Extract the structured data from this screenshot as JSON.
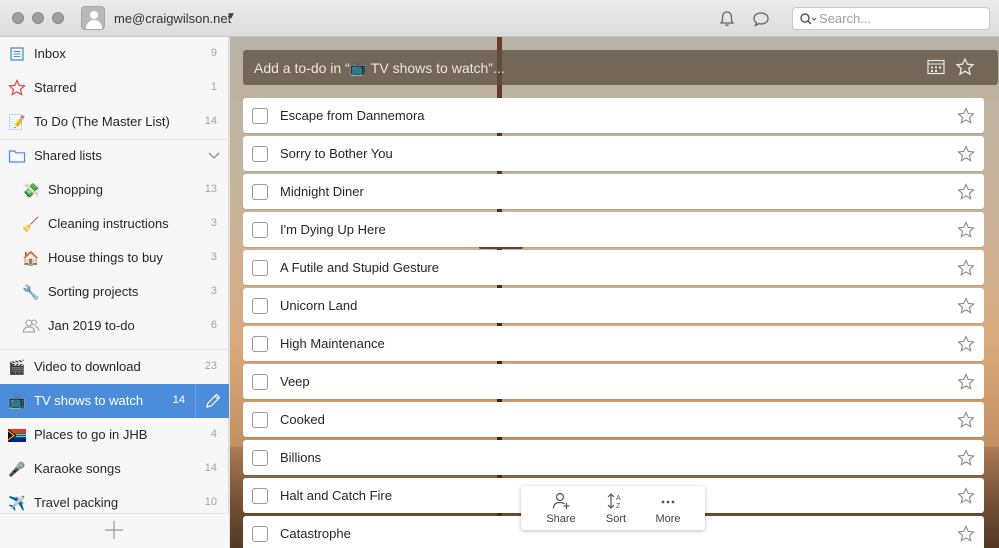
{
  "titlebar": {
    "user_email": "me@craigwilson.net",
    "icons": [
      "bell-icon",
      "chat-bubble-icon",
      "search-icon"
    ]
  },
  "search": {
    "placeholder": "Search..."
  },
  "sidebar": {
    "items": [
      {
        "label": "Inbox",
        "count": "9",
        "icon": "inbox-icon"
      },
      {
        "label": "Starred",
        "count": "1",
        "icon": "star-icon"
      },
      {
        "label": "To Do (The Master List)",
        "count": "14",
        "icon": "memo-emoji-icon"
      },
      {
        "label": "Shared lists",
        "count": "",
        "icon": "folder-icon"
      },
      {
        "label": "Shopping",
        "count": "13",
        "icon": "money-emoji-icon"
      },
      {
        "label": "Cleaning instructions",
        "count": "3",
        "icon": "broom-emoji-icon"
      },
      {
        "label": "House things to buy",
        "count": "3",
        "icon": "house-emoji-icon"
      },
      {
        "label": "Sorting projects",
        "count": "3",
        "icon": "wrench-emoji-icon"
      },
      {
        "label": "Jan 2019 to-do",
        "count": "6",
        "icon": "people-icon"
      },
      {
        "label": "Video to download",
        "count": "23",
        "icon": "clapper-emoji-icon"
      },
      {
        "label": "TV shows to watch",
        "count": "14",
        "icon": "tv-emoji-icon"
      },
      {
        "label": "Places to go in JHB",
        "count": "4",
        "icon": "south-africa-flag-icon"
      },
      {
        "label": "Karaoke songs",
        "count": "14",
        "icon": "microphone-emoji-icon"
      },
      {
        "label": "Travel packing",
        "count": "10",
        "icon": "airplane-emoji-icon"
      }
    ]
  },
  "add_todo": {
    "placeholder": "Add a to-do in “📺 TV shows to watch”..."
  },
  "tasks": [
    "Escape from Dannemora",
    "Sorry to Bother You",
    "Midnight Diner",
    "I'm Dying Up Here",
    "A Futile and Stupid Gesture",
    "Unicorn Land",
    "High Maintenance",
    "Veep",
    "Cooked",
    "Billions",
    "Halt and Catch Fire",
    "Catastrophe"
  ],
  "bottom_bar": {
    "share": "Share",
    "sort": "Sort",
    "more": "More"
  },
  "colors": {
    "accent": "#4c8ddb",
    "star_red": "#e0473d",
    "folder_blue": "#4c8ddb"
  }
}
